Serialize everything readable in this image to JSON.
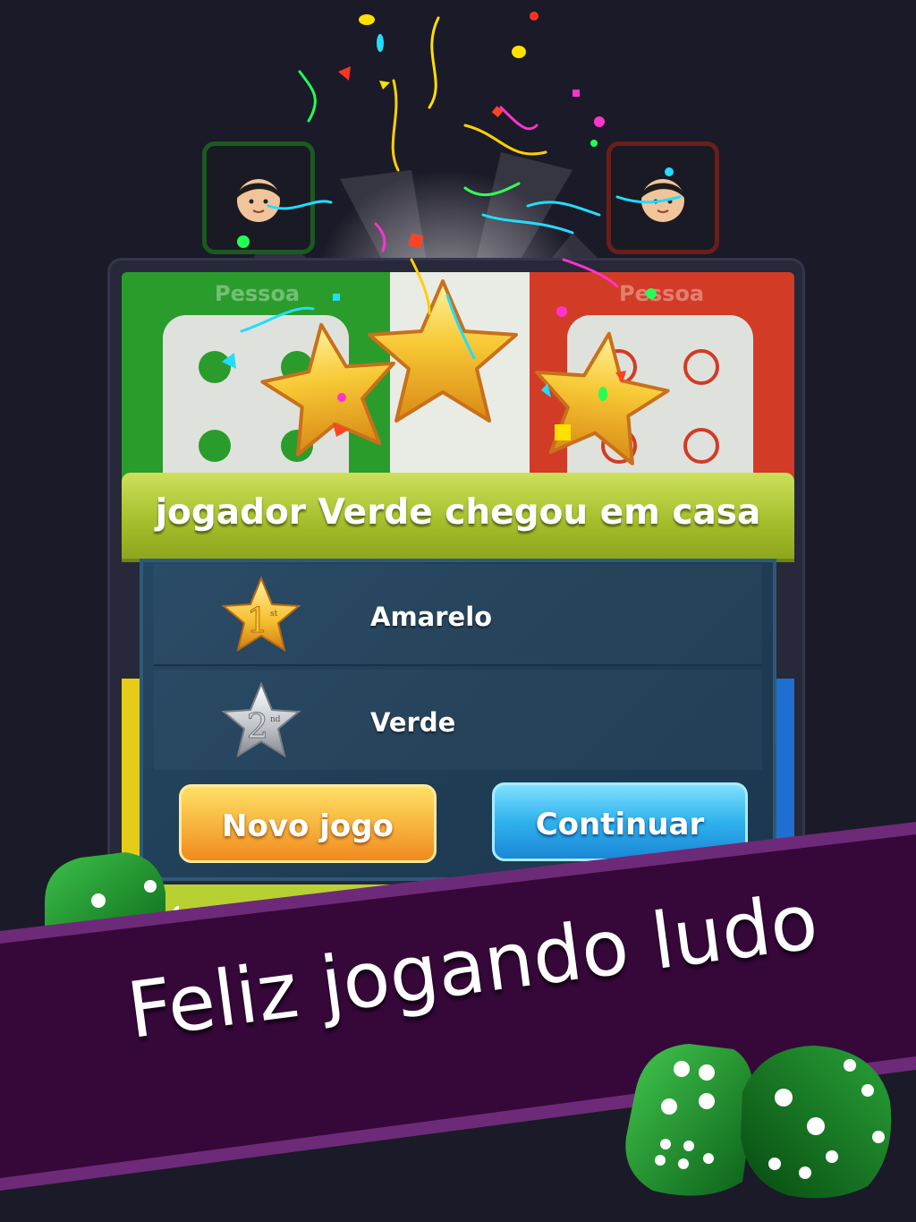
{
  "colors": {
    "background": "#1b1a28",
    "green": "#2a9c2c",
    "red": "#d23b26",
    "yellow": "#e5cc1a",
    "blue": "#1f6fd0",
    "banner": "#a5c02d",
    "band": "#3a0d3d",
    "band_edge": "#6d2a78"
  },
  "players": {
    "top_left": {
      "label": "Pessoa",
      "color": "green"
    },
    "top_right": {
      "label": "Pessoa",
      "color": "red"
    }
  },
  "dialog": {
    "title": "jogador Verde chegou em casa",
    "stars_earned": 3,
    "results": [
      {
        "rank_number": "1",
        "rank_suffix": "st",
        "name": "Amarelo",
        "medal": "gold"
      },
      {
        "rank_number": "2",
        "rank_suffix": "nd",
        "name": "Verde",
        "medal": "silver"
      }
    ],
    "new_game_label": "Novo jogo",
    "continue_label": "Continuar"
  },
  "promo": {
    "slogan": "Feliz jogando ludo"
  },
  "icons": [
    "avatar-face-icon",
    "gold-star-icon",
    "medal-star-icon",
    "dice-icon",
    "confetti"
  ]
}
